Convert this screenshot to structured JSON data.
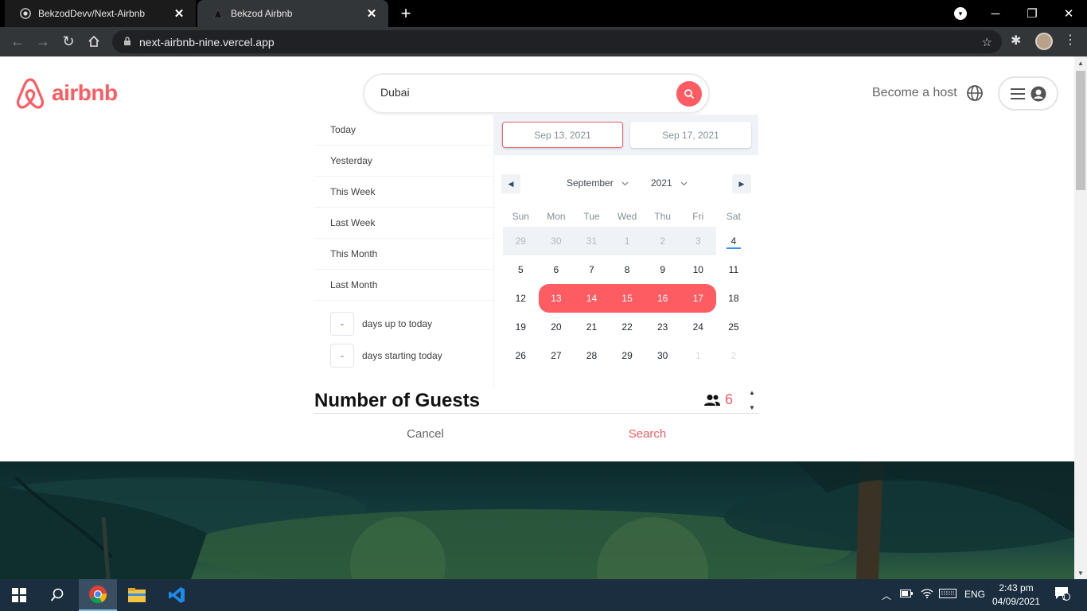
{
  "browser": {
    "tabs": [
      {
        "title": "BekzodDevv/Next-Airbnb",
        "icon": "github-icon"
      },
      {
        "title": "Bekzod Airbnb",
        "icon": "vercel-icon"
      }
    ],
    "url": "next-airbnb-nine.vercel.app"
  },
  "header": {
    "logo_text": "airbnb",
    "search_value": "Dubai",
    "host_link": "Become a host"
  },
  "date_picker": {
    "static_ranges": [
      "Today",
      "Yesterday",
      "This Week",
      "Last Week",
      "This Month",
      "Last Month"
    ],
    "input_ranges": [
      {
        "value": "-",
        "label": "days up to today"
      },
      {
        "value": "-",
        "label": "days starting today"
      }
    ],
    "start_display": "Sep 13, 2021",
    "end_display": "Sep 17, 2021",
    "month": "September",
    "year": "2021",
    "weekdays": [
      "Sun",
      "Mon",
      "Tue",
      "Wed",
      "Thu",
      "Fri",
      "Sat"
    ],
    "days": [
      [
        "29",
        "30",
        "31",
        "1",
        "2",
        "3",
        "4"
      ],
      [
        "5",
        "6",
        "7",
        "8",
        "9",
        "10",
        "11"
      ],
      [
        "12",
        "13",
        "14",
        "15",
        "16",
        "17",
        "18"
      ],
      [
        "19",
        "20",
        "21",
        "22",
        "23",
        "24",
        "25"
      ],
      [
        "26",
        "27",
        "28",
        "29",
        "30",
        "1",
        "2"
      ]
    ],
    "selected_start": "13",
    "selected_end": "17",
    "today": "4"
  },
  "guests": {
    "title": "Number of Guests",
    "count": "6"
  },
  "actions": {
    "cancel": "Cancel",
    "search": "Search"
  },
  "taskbar": {
    "language": "ENG",
    "time": "2:43 pm",
    "date": "04/09/2021",
    "notifications": "1"
  },
  "colors": {
    "brand": "#fd5c63",
    "chrome_dark": "#323639",
    "taskbar": "#1b2e40"
  }
}
